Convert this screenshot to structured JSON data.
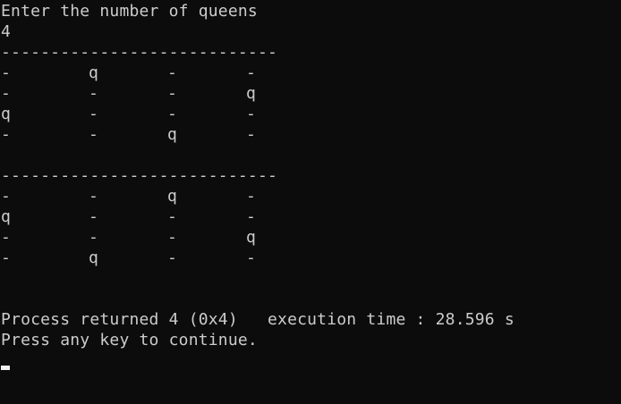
{
  "console": {
    "prompt": "Enter the number of queens",
    "input": "4",
    "separator": "----------------------------",
    "solutions": [
      [
        [
          "-",
          "q",
          "-",
          "-"
        ],
        [
          "-",
          "-",
          "-",
          "q"
        ],
        [
          "q",
          "-",
          "-",
          "-"
        ],
        [
          "-",
          "-",
          "q",
          "-"
        ]
      ],
      [
        [
          "-",
          "-",
          "q",
          "-"
        ],
        [
          "q",
          "-",
          "-",
          "-"
        ],
        [
          "-",
          "-",
          "-",
          "q"
        ],
        [
          "-",
          "q",
          "-",
          "-"
        ]
      ]
    ],
    "process_line": "Process returned 4 (0x4)   execution time : 28.596 s",
    "continue_line": "Press any key to continue."
  },
  "colors": {
    "background": "#0c0c0c",
    "text": "#cccccc",
    "cursor": "#f2f2f2"
  }
}
